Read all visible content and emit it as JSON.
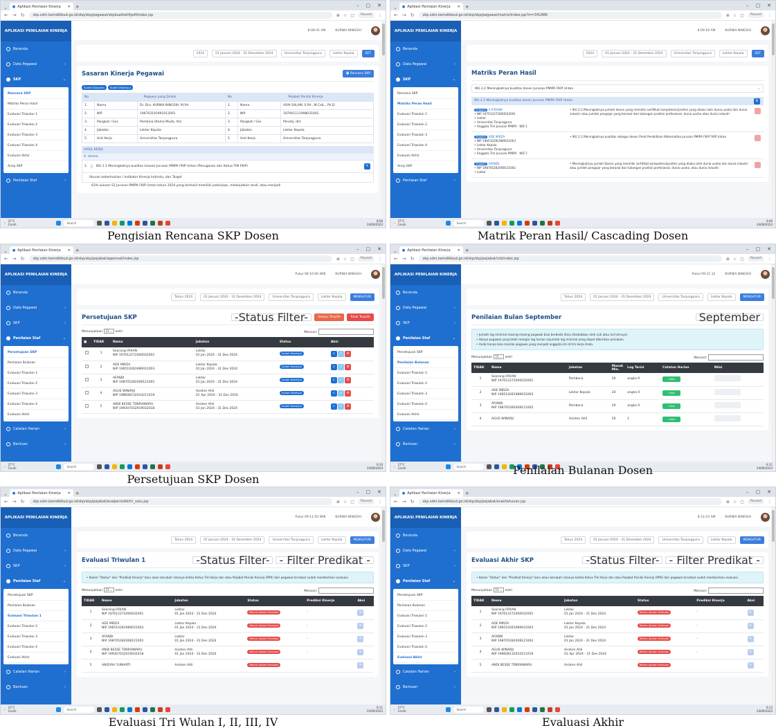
{
  "browser": {
    "tab_title": "Aplikasi Penilaian Kinerja",
    "url_prefix": "skp.sdm.kemdikbud.go.id/skp/",
    "profile": "Paused"
  },
  "app": {
    "brand": "APLIKASI PENILAIAN KINERJA",
    "user": "KURNIA NINGSIH",
    "nav": {
      "beranda": "Beranda",
      "data_pegawai": "Data Pegawai",
      "skp": "SKP",
      "penilaian_staf": "Penilaian Staf",
      "catatan_harian": "Catatan Harian",
      "bantuan": "Bantuan"
    },
    "skp_menu": [
      "Rencana SKP",
      "Matriks Peran Hasil",
      "Evaluasi Triwulan 1",
      "Evaluasi Triwulan 2",
      "Evaluasi Triwulan 3",
      "Evaluasi Triwulan 4",
      "Evaluasi Akhir",
      "Arsip SKP"
    ],
    "staf_menu": [
      "Persetujuan SKP",
      "Penilaian Bulanan",
      "Evaluasi Triwulan 1",
      "Evaluasi Triwulan 2",
      "Evaluasi Triwulan 3",
      "Evaluasi Triwulan 4",
      "Evaluasi Akhir"
    ],
    "filter": {
      "year": "2024",
      "year_label": "Tahun 2024",
      "period": "01 Januari 2024 - 31 Desember 2024",
      "unit": "Universitas Tanjungpura",
      "jabatan": "Lektor Kepala",
      "set_button": "SET",
      "apply_button": "MENGATUR"
    },
    "taskbar": {
      "weather_temp": "27°C",
      "weather_desc": "Cerah",
      "search": "Search",
      "date": "24/09/2024"
    }
  },
  "screens": {
    "s1": {
      "caption": "Pengisian Rencana SKP Dosen",
      "path": "skp/pegawai/skpkualitatif/pdf/index.jsp",
      "time": "8:08:41 AM",
      "clock": "8:08",
      "title": "Sasaran Kinerja Pegawai",
      "action": "Rencana SKP",
      "badges": [
        "Sudah Diajukan",
        "Sudah Disetujui"
      ],
      "head": {
        "no": "No",
        "pegawai": "Pegawai yang Dinilai",
        "pejabat": "Pejabat Penilai Kinerja"
      },
      "rows": [
        {
          "n": "1.",
          "k": "Nama",
          "v": "Dr. Dra. KURNIA NINGSIH, M.Pd.",
          "n2": "1.",
          "k2": "Nama",
          "v2": "URAI SALAM, S.Pd., M.CalL., Ph.D."
        },
        {
          "n": "2.",
          "k": "NIP",
          "v": "196703191991012001",
          "n2": "2.",
          "k2": "NIP",
          "v2": "197001111998031001"
        },
        {
          "n": "3.",
          "k": "Pangkat / Gol.",
          "v": "Pembina Utama Muda, IV/c",
          "n2": "3.",
          "k2": "Pangkat / Gol.",
          "v2": "Penata, III/c"
        },
        {
          "n": "4.",
          "k": "Jabatan",
          "v": "Lektor Kepala",
          "n2": "4.",
          "k2": "Jabatan",
          "v2": "Lektor Kepala"
        },
        {
          "n": "5.",
          "k": "Unit Kerja",
          "v": "Universitas Tanjungpura",
          "n2": "5.",
          "k2": "Unit Kerja",
          "v2": "Universitas Tanjungpura"
        }
      ],
      "hasil": "HASIL KERJA",
      "utama": "A. Utama",
      "iku": "IKU 1.1 Meningkatnya kualitas lulusan Jurusan PMIPA FKIP Untan (Penugasan dari Ketua TIM FKIP)",
      "ukuran": "Ukuran keberhasilan / Indikator Kinerja Individu, dan Target",
      "bullet": "63% lulusan S1 Jurusan PMIPA FKIP Untan tahun 2024 yang berhasil memiliki pekerjaan, melanjutkan studi, atau menjadi"
    },
    "s2": {
      "caption": "Matrik Peran Hasil/ Cascading Dosen",
      "path": "skp/pegawai/matrix/index.jsp?m=341886",
      "time": "9:09:18 AM",
      "clock": "9:09",
      "title": "Matriks Peran Hasil",
      "select": "IKU 2.2 Meningkatnya kualitas dosen Jurusan PMIPA FKIP Untan",
      "header": "IKU 2.2 Meningkatnya kualitas dosen Jurusan PMIPA FKIP Untan",
      "rows": [
        {
          "tag": "Anggota",
          "name": "A IFRIANY",
          "nip": "NIP 197012272000032001",
          "jab": "Lektor",
          "unit": "Universitas Tanjungpura",
          "tim": "Anggota Tim Jurusan PMIPA - WD 1",
          "text": "IKU 2.2 Meningkatnya jumlah dosen yang memiliki sertifikat kompetensi/profesi yang diakui oleh dunia usaha dan dunia industri atau jumlah pengajar yang berasal dari kalangan praktisi profesional, dunia usaha atau dunia industri"
        },
        {
          "tag": "Anggota",
          "name": "ADE MIRZA",
          "nip": "NIP 196510281989031003",
          "jab": "Lektor Kepala",
          "unit": "Universitas Tanjungpura",
          "tim": "Anggota Tim Jurusan PMIPA - WD 1",
          "text": "IKU 2.2 Meningkatnya kualitas sebagai dosen Prodi Pendidikan Matematika Jurusan PMIPA FKIP FKIP Untan"
        },
        {
          "tag": "Anggota",
          "name": "AFANDI",
          "nip": "NIP 198705282008121002",
          "jab": "Lektor",
          "unit": "",
          "tim": "",
          "text": "Meningkatnya jumlah Dosen yang memiliki sertifikat kompetensi/profesi yang diakui oleh dunia usaha dan dunia industri atau jumlah pengajar yang berasal dari kalangan praktisi profesional, dunia usaha, atau dunia industri"
        }
      ]
    },
    "s3": {
      "caption": "Persetujuan SKP Dosen",
      "path": "skp/pejabat/approval/index.jsp",
      "time": "Pukul 08:10:00 WIB",
      "clock": "9:10",
      "title": "Persetujuan SKP",
      "status_filter": "-Status Filter-",
      "approve": "Setujui Terpilih",
      "reject": "Tolak Terpilih",
      "show": "Menunjukkan",
      "entries": "entri",
      "search": "Mencari:",
      "cols": {
        "tidak": "TIDAK",
        "nama": "Nama",
        "jabatan": "Jabatan",
        "status": "Status",
        "aksi": "Aksi"
      },
      "rows": [
        {
          "no": "1",
          "name": "Seorang IFRIAN",
          "nip": "NIP 197012272000032001",
          "jab": "Lektor",
          "per": "01 Jan 2024 - 31 Des 2024",
          "status": "Sudah Disetujui"
        },
        {
          "no": "2",
          "name": "ADE MIRZA",
          "nip": "NIP 196510281989031003",
          "jab": "Lektor Kepala",
          "per": "01 Jan 2024 - 31 Des 2024",
          "status": "Sudah Disetujui"
        },
        {
          "no": "3",
          "name": "AFANDI",
          "nip": "NIP 198705282008121002",
          "jab": "Lektor",
          "per": "01 Jan 2024 - 31 Des 2024",
          "status": "Sudah Disetujui"
        },
        {
          "no": "4",
          "name": "AGUS WINARJI",
          "nip": "NIP 198608132024211019",
          "jab": "Asisten Ahli",
          "per": "01 Apr 2024 - 31 Des 2024",
          "status": "Sudah Disetujui"
        },
        {
          "no": "5",
          "name": "ANDI BESSE TENRIAWARU",
          "nip": "NIP 199307032019032018",
          "jab": "Asisten Ahli",
          "per": "01 Jan 2024 - 31 Des 2024",
          "status": "Sudah Disetujui"
        }
      ]
    },
    "s4": {
      "caption": "Penilaian Bulanan Dosen",
      "path": "skp/pejabat/rcb/index.jsp",
      "time": "Pukul 09:11:12",
      "clock": "9:11",
      "title": "Penilaian Bulan September",
      "month": "September",
      "info": [
        "Jumlah log minimal masing-masing pegawai bisa berbeda (bisa disebabkan oleh cuti atau hal lainnya).",
        "Hanya pegawai yang telah mengisi log harian sejumlah log minimal yang dapat diberikan penilaian.",
        "Anda hanya bisa menilai pegawai yang menjadi anggota inti di tim kerja Anda."
      ],
      "show": "Menunjukkan",
      "entries": "entri",
      "search": "Mencari:",
      "cols": {
        "tidak": "TIDAK",
        "nama": "Nama",
        "jabatan": "Jabatan",
        "masuk": "Masuk Min.",
        "log": "Log Terisi",
        "catatan": "Catatan Harian",
        "nilai": "Nilai"
      },
      "lihat": "Lihat",
      "rows": [
        {
          "no": "1",
          "name": "Seorang IFRIAN",
          "nip": "NIP 197012272000032001",
          "jab": "Pembaca",
          "min": "20",
          "log": "angka 0"
        },
        {
          "no": "2",
          "name": "ADE MIRZA",
          "nip": "NIP 196510281989031003",
          "jab": "Lektor Kepala",
          "min": "20",
          "log": "angka 0"
        },
        {
          "no": "3",
          "name": "AFANDI",
          "nip": "NIP 198705282008121002",
          "jab": "Pembaca",
          "min": "20",
          "log": "angka 0"
        },
        {
          "no": "4",
          "name": "AGUS WINARJI",
          "nip": "",
          "jab": "Asisten Ahli",
          "min": "20",
          "log": "1"
        }
      ]
    },
    "s5": {
      "caption": "Evaluasi Tri Wulan I, II, III, IV",
      "path": "skp/pejabat/evalperiodik/tri_satu.jsp",
      "time": "Pukul 09:11:50 WIB",
      "clock": "9:11",
      "title": "Evaluasi Triwulan 1",
      "status_filter": "-Status Filter-",
      "predikat_filter": "- Filter Predikat -",
      "info": "Kolom \"Status\" dan \"Predikat Kinerja\" baru akan berubah nilainya ketika Ketua Tim Kerja dan atau Pejabat Penilai Kinerja (PPK) dari pegawai tersebut sudah memberikan evaluasi.",
      "show": "Menunjukkan",
      "entries": "entri",
      "search": "Mencari:",
      "cols": {
        "tidak": "TIDAK",
        "nama": "Nama",
        "jabatan": "Jabatan",
        "status": "Status",
        "prediksi": "Prediksi Kinerja",
        "aksi": "Aksi"
      },
      "rows": [
        {
          "no": "1",
          "name": "Seorang IFRIAN",
          "nip": "NIP 197012272000032001",
          "jab": "Lektor",
          "per": "01 Jan 2024 - 31 Des 2024",
          "status": "Belum Ajukan Evaluasi",
          "pred": "-"
        },
        {
          "no": "2",
          "name": "ADE MIRZA",
          "nip": "NIP 196510281989031003",
          "jab": "Lektor Kepala",
          "per": "01 Jan 2024 - 31 Des 2024",
          "status": "Belum Ajukan Evaluasi",
          "pred": "-"
        },
        {
          "no": "3",
          "name": "AFANDI",
          "nip": "NIP 198705282008121002",
          "jab": "Lektor",
          "per": "01 Jan 2024 - 31 Des 2024",
          "status": "Belum Ajukan Evaluasi",
          "pred": "-"
        },
        {
          "no": "4",
          "name": "ANDI BESSE TENRIAWARU",
          "nip": "NIP 199307032019032018",
          "jab": "Asisten Ahli",
          "per": "01 Jan 2024 - 31 Des 2024",
          "status": "Belum Ajukan Evaluasi",
          "pred": "-"
        },
        {
          "no": "5",
          "name": "ANISYAH YUNIARTI",
          "nip": "",
          "jab": "Asisten Ahli",
          "per": "",
          "status": "Belum Ajukan Evaluasi",
          "pred": ""
        }
      ]
    },
    "s6": {
      "caption": "Evaluasi Akhir",
      "path": "skp/pejabat/eval/tahunan.jsp",
      "time": "8:12:23 AM",
      "clock": "9:12",
      "title": "Evaluasi Akhir SKP",
      "status_filter": "-Status Filter-",
      "predikat_filter": "- Filter Predikat -",
      "info": "Kolom \"Status\" dan \"Predikat Kinerja\" baru akan berubah nilainya ketika Ketua Tim Kerja dan atau Pejabat Penilai Kinerja (PPK) dari pegawai tersebut sudah memberikan evaluasi.",
      "show": "Menunjukkan",
      "entries": "entri",
      "search": "Mencari:",
      "cols": {
        "tidak": "TIDAK",
        "nama": "Nama",
        "jabatan": "Jabatan",
        "status": "Status",
        "prediksi": "Prediksi Kinerja",
        "aksi": "Aksi"
      },
      "rows": [
        {
          "no": "1",
          "name": "Seorang IFRIAN",
          "nip": "NIP 197012272000032001",
          "jab": "Lektor",
          "per": "01 Jan 2024 - 31 Des 2024",
          "status": "Belum Ajukan Evaluasi",
          "pred": "-"
        },
        {
          "no": "2",
          "name": "ADE MIRZA",
          "nip": "NIP 196510281989031003",
          "jab": "Lektor Kepala",
          "per": "01 Jan 2024 - 31 Des 2024",
          "status": "Belum Ajukan Evaluasi",
          "pred": "-"
        },
        {
          "no": "3",
          "name": "AFANDI",
          "nip": "NIP 198705282008121002",
          "jab": "Lektor",
          "per": "01 Jan 2024 - 31 Des 2024",
          "status": "Belum Ajukan Evaluasi",
          "pred": "-"
        },
        {
          "no": "4",
          "name": "AGUS WINARJI",
          "nip": "NIP 198608132024211019",
          "jab": "Asisten Ahli",
          "per": "01 Apr 2024 - 31 Des 2024",
          "status": "Belum Ajukan Evaluasi",
          "pred": "-"
        },
        {
          "no": "5",
          "name": "ANDI BESSE TENRIAWARU",
          "nip": "",
          "jab": "Asisten Ahli",
          "per": "",
          "status": "Belum Ajukan Evaluasi",
          "pred": ""
        }
      ]
    }
  }
}
